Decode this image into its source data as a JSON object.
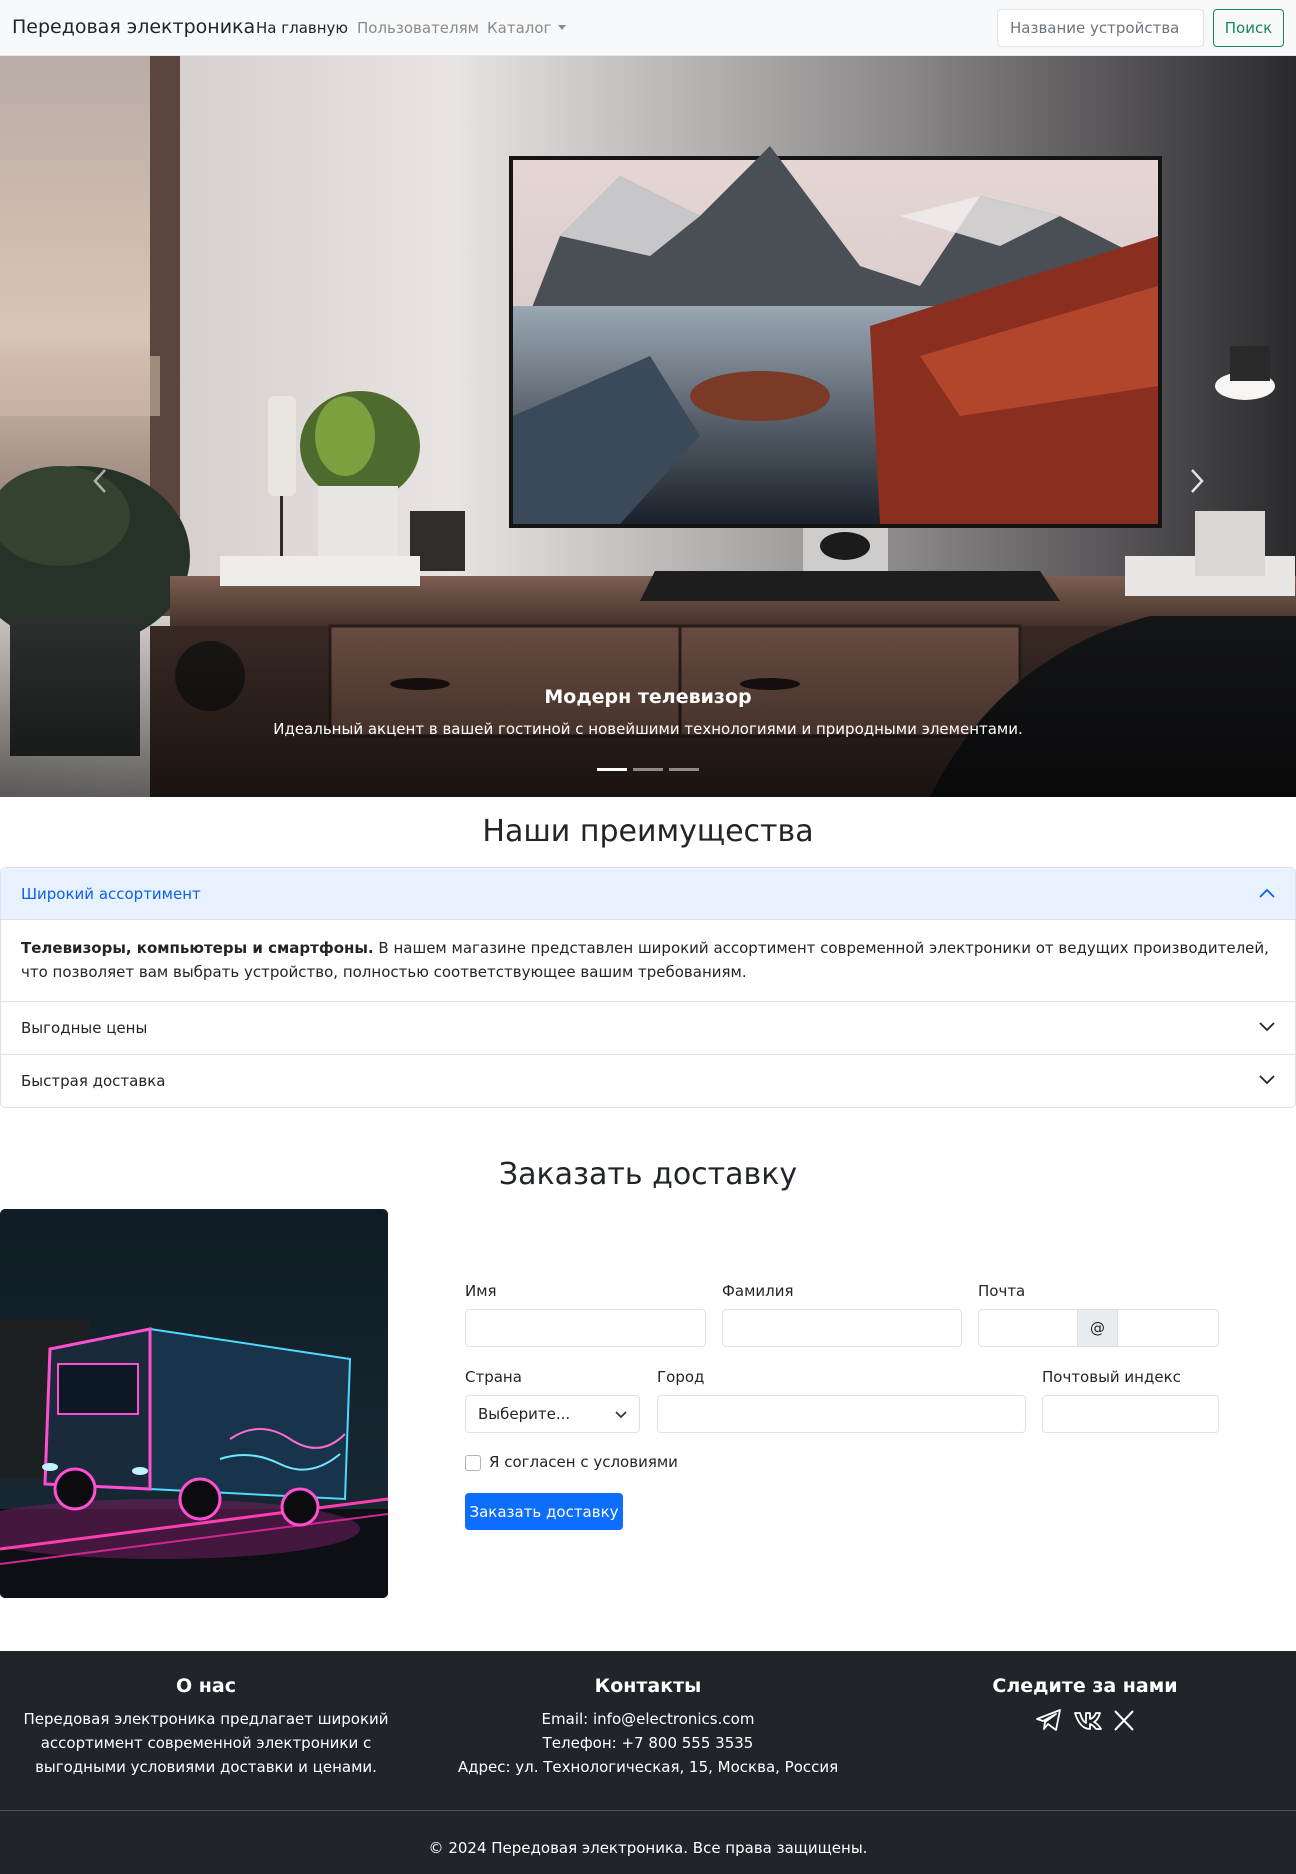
{
  "navbar": {
    "brand": "Передовая электроника",
    "links": [
      "На главную",
      "Пользователям",
      "Каталог"
    ],
    "search_placeholder": "Название устройства",
    "search_button": "Поиск"
  },
  "carousel": {
    "caption_title": "Модерн телевизор",
    "caption_text": "Идеальный акцент в вашей гостиной с новейшими технологиями и природными элементами.",
    "slides_count": 3,
    "active_slide": 1
  },
  "advantages": {
    "title": "Наши преимущества",
    "items": [
      {
        "title": "Широкий ассортимент",
        "open": true,
        "body_bold": "Телевизоры, компьютеры и смартфоны.",
        "body_text": " В нашем магазине представлен широкий ассортимент современной электроники от ведущих производителей, что позволяет вам выбрать устройство, полностью соответствующее вашим требованиям."
      },
      {
        "title": "Выгодные цены",
        "open": false
      },
      {
        "title": "Быстрая доставка",
        "open": false
      }
    ]
  },
  "order": {
    "title": "Заказать доставку",
    "labels": {
      "first_name": "Имя",
      "last_name": "Фамилия",
      "email": "Почта",
      "country": "Страна",
      "city": "Город",
      "zip": "Почтовый индекс"
    },
    "email_addon": "@",
    "country_selected": "Выберите...",
    "agree": "Я согласен с условиями",
    "submit": "Заказать доставку"
  },
  "footer": {
    "about_title": "О нас",
    "about_text": "Передовая электроника предлагает широкий ассортимент современной электроники с выгодными условиями доставки и ценами.",
    "contacts_title": "Контакты",
    "email": "Email: info@electronics.com",
    "phone": "Телефон: +7 800 555 3535",
    "address": "Адрес: ул. Технологическая, 15, Москва, Россия",
    "follow_title": "Следите за нами",
    "social_icons": [
      "telegram-icon",
      "vk-icon",
      "x-icon"
    ],
    "copyright": "© 2024 Передовая электроника. Все права защищены."
  },
  "colors": {
    "primary": "#0d6efd",
    "success": "#198754",
    "footer_bg": "#212529",
    "accordion_open_bg": "#e7f1ff"
  }
}
